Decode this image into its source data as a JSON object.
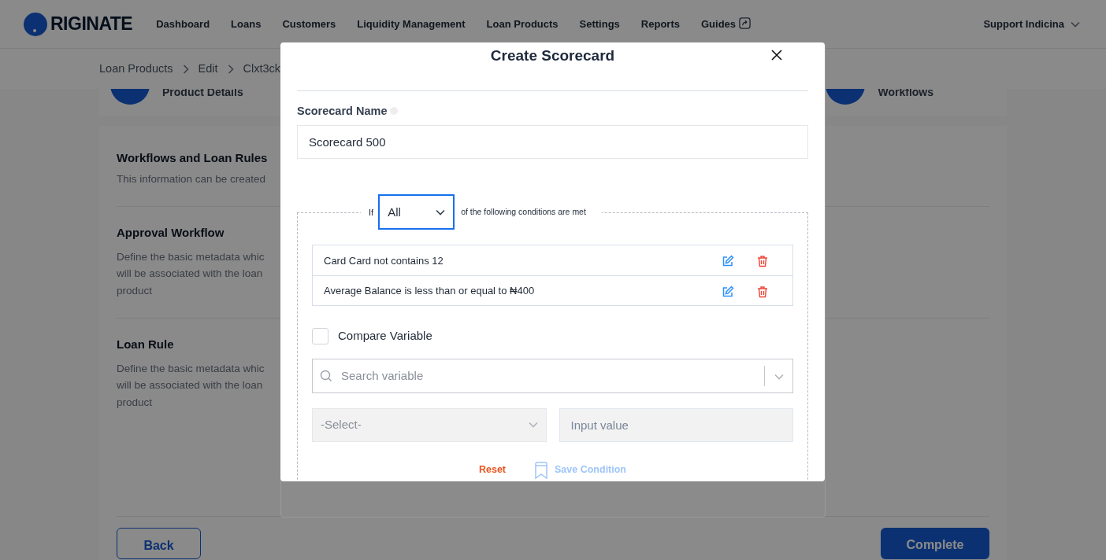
{
  "brand": {
    "logo_text": "RIGINATE"
  },
  "nav": [
    {
      "label": "Dashboard",
      "kind": "link"
    },
    {
      "label": "Loans",
      "kind": "link"
    },
    {
      "label": "Customers",
      "kind": "link"
    },
    {
      "label": "Liquidity Management",
      "kind": "link"
    },
    {
      "label": "Loan Products",
      "kind": "link"
    },
    {
      "label": "Settings",
      "kind": "link"
    },
    {
      "label": "Reports",
      "kind": "link"
    },
    {
      "label": "Guides",
      "kind": "external"
    }
  ],
  "user_menu": {
    "label": "Support Indicina"
  },
  "breadcrumb": [
    "Loan Products",
    "Edit",
    "Clxt3ck"
  ],
  "steps": [
    {
      "label": "Product Details"
    },
    {
      "label": "Workflows"
    }
  ],
  "sections": [
    {
      "title": "Workflows and Loan Rules",
      "description_lines": [
        "This information can be created"
      ],
      "kind": "header"
    },
    {
      "title": "Approval Workflow",
      "description_lines": [
        "Define the basic metadata whic",
        "will be associated with the loan",
        "product"
      ],
      "kind": "item"
    },
    {
      "title": "Loan Rule",
      "description_lines": [
        "Define the basic metadata whic",
        "will be associated with the loan",
        "product"
      ],
      "kind": "item"
    }
  ],
  "footer_buttons": [
    {
      "label": "Back",
      "kind": "secondary"
    },
    {
      "label": "Complete",
      "kind": "primary"
    }
  ],
  "modal": {
    "title": "Create Scorecard",
    "name_field": {
      "label": "Scorecard Name",
      "value": "Scorecard 500"
    },
    "condition_group": {
      "prefix": "If",
      "match": "All",
      "suffix": "of the following conditions are met"
    },
    "conditions": [
      {
        "text": "Card Card not contains 12"
      },
      {
        "text": "Average Balance is less than or equal to ₦400"
      }
    ],
    "compare_variable": {
      "label": "Compare Variable",
      "checked": false
    },
    "variable_search": {
      "placeholder": "Search variable"
    },
    "operator_select": {
      "placeholder": "-Select-",
      "disabled": true
    },
    "value_input": {
      "placeholder": "Input value",
      "disabled": true
    },
    "actions": [
      {
        "label": "Reset",
        "kind": "reset",
        "disabled": false
      },
      {
        "label": "Save Condition",
        "kind": "save",
        "disabled": true
      }
    ]
  }
}
